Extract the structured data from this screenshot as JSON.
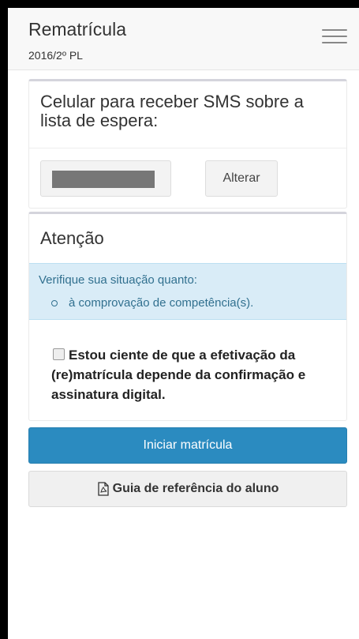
{
  "header": {
    "title": "Rematrícula",
    "subtitle": "2016/2º PL",
    "menu_icon": "hamburger-icon"
  },
  "sms_panel": {
    "heading": "Celular para receber SMS sobre a lista de espera:",
    "phone_value": "",
    "change_button": "Alterar"
  },
  "attention_panel": {
    "heading": "Atenção",
    "alert_text": "Verifique sua situação quanto:",
    "alert_items": [
      "à comprovação de competência(s)."
    ],
    "consent_text": "Estou ciente de que a efetivação da (re)matrícula depende da confirmação e assinatura digital.",
    "consent_checked": false
  },
  "actions": {
    "start_button": "Iniciar matrícula",
    "guide_button": "Guia de referência do aluno",
    "guide_icon": "pdf-icon"
  },
  "colors": {
    "primary": "#2b8bc0",
    "alert_bg": "#d9ecf7",
    "alert_text": "#31708f"
  }
}
